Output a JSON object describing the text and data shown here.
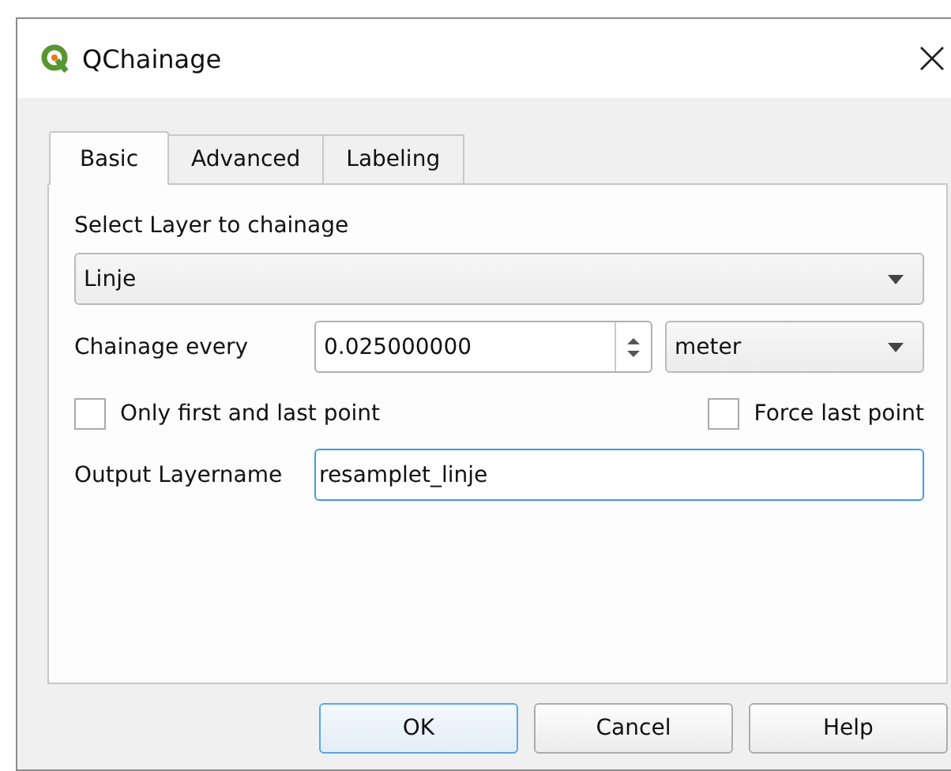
{
  "window": {
    "title": "QChainage"
  },
  "tabs": [
    {
      "label": "Basic",
      "selected": true
    },
    {
      "label": "Advanced",
      "selected": false
    },
    {
      "label": "Labeling",
      "selected": false
    }
  ],
  "layer": {
    "label": "Select Layer to chainage",
    "value": "Linje"
  },
  "interval": {
    "label": "Chainage every",
    "value": "0.025000000",
    "unit": "meter"
  },
  "checkboxes": [
    {
      "label": "Only first and last point",
      "checked": false
    },
    {
      "label": "Force last point",
      "checked": false
    }
  ],
  "output": {
    "label": "Output Layername",
    "value": "resamplet_linje",
    "focused": true
  },
  "buttons": [
    {
      "label": "OK",
      "default": true
    },
    {
      "label": "Cancel",
      "default": false
    },
    {
      "label": "Help",
      "default": false
    }
  ]
}
